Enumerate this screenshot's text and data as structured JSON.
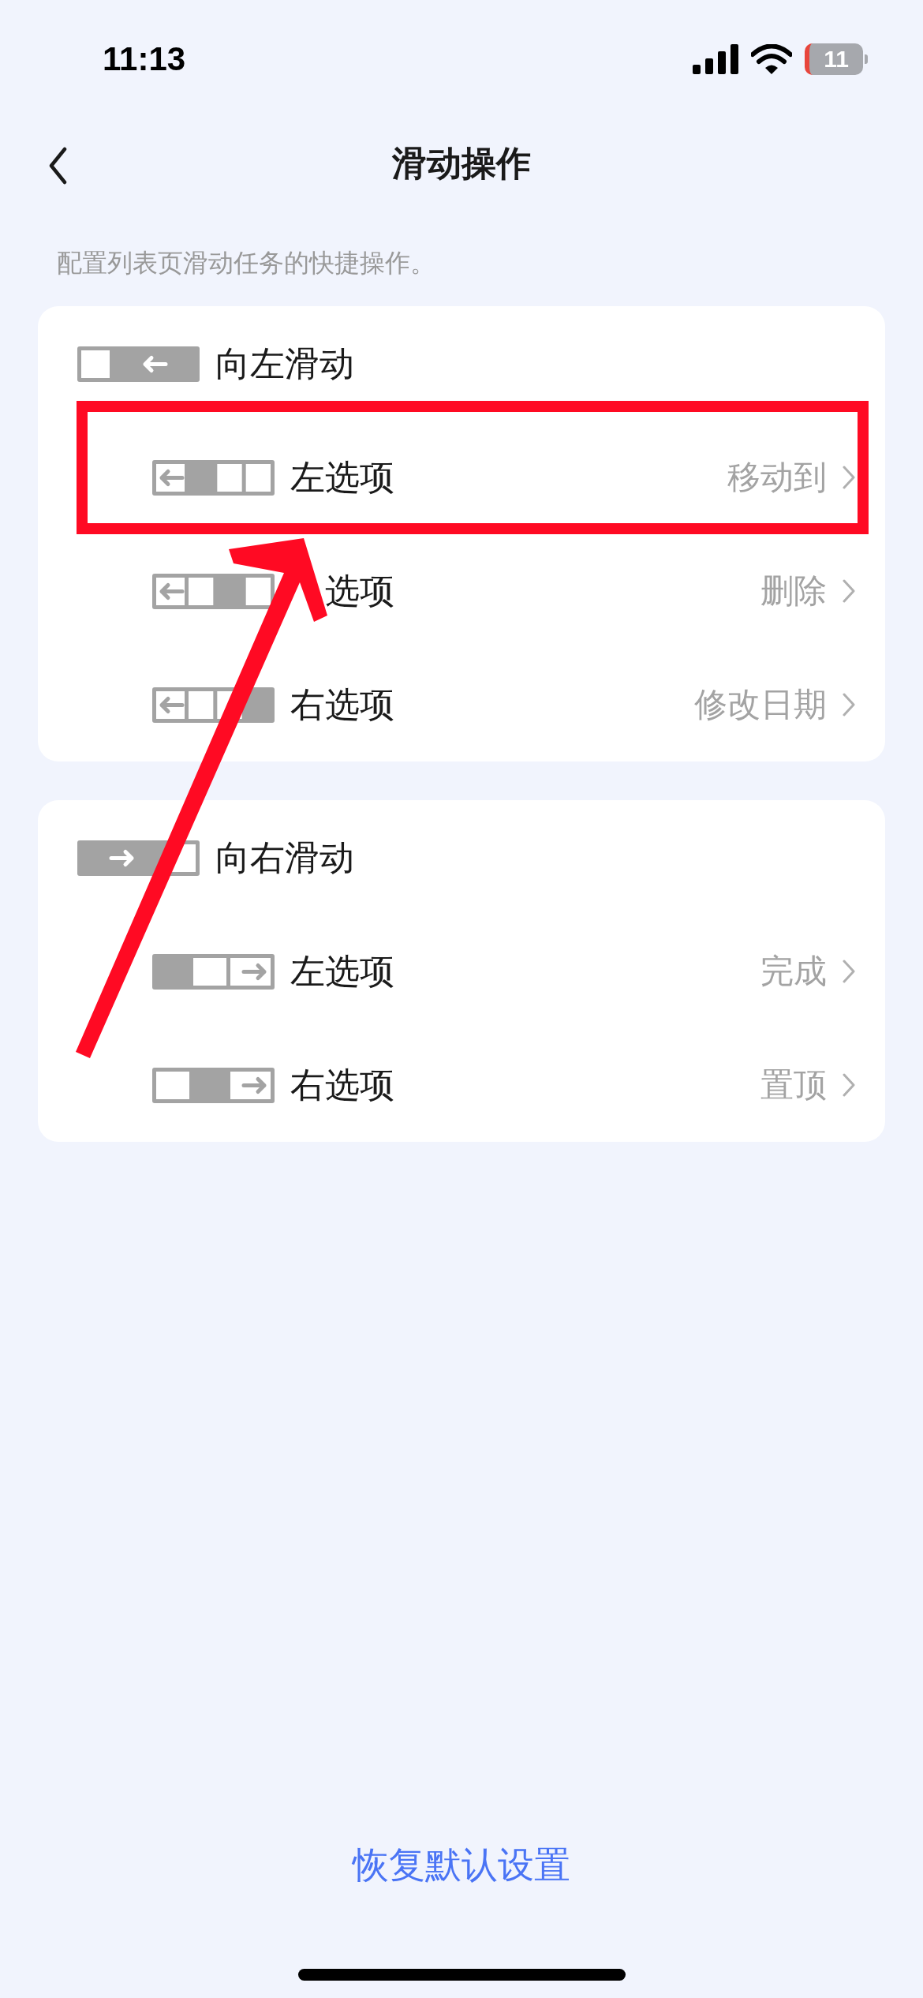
{
  "status_bar": {
    "time": "11:13",
    "battery": "11"
  },
  "nav": {
    "title": "滑动操作"
  },
  "description": "配置列表页滑动任务的快捷操作。",
  "groups": [
    {
      "kind": "left",
      "title": "向左滑动",
      "options": [
        {
          "kind": "left",
          "label": "左选项",
          "value": "移动到"
        },
        {
          "kind": "middle",
          "label": "选项",
          "value": "删除",
          "covered": true
        },
        {
          "kind": "right",
          "label": "右选项",
          "value": "修改日期"
        }
      ]
    },
    {
      "kind": "right",
      "title": "向右滑动",
      "options": [
        {
          "kind": "left",
          "label": "左选项",
          "value": "完成"
        },
        {
          "kind": "right",
          "label": "右选项",
          "value": "置顶"
        }
      ]
    }
  ],
  "reset_button": "恢复默认设置"
}
